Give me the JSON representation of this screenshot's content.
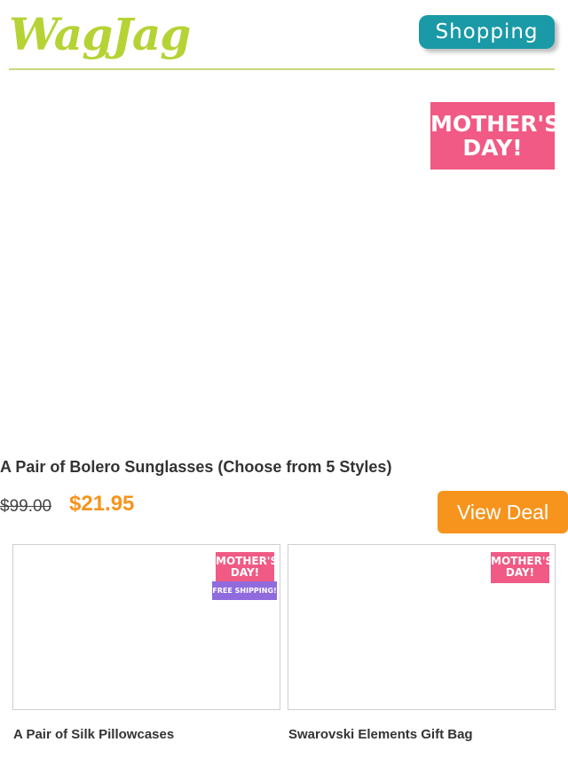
{
  "header": {
    "logo_text": "WagJag",
    "shopping_label": "Shopping"
  },
  "featured_deal": {
    "badge_line1": "MOTHER'S",
    "badge_line2": "DAY!",
    "title": "A Pair of Bolero Sunglasses (Choose from 5 Styles)",
    "original_price": "$99.00",
    "deal_price": "$21.95",
    "cta_label": "View Deal"
  },
  "deals": [
    {
      "title": "A Pair of Silk Pillowcases",
      "badge_line1": "MOTHER'S",
      "badge_line2": "DAY!",
      "shipping_tag": "FREE SHIPPING!"
    },
    {
      "title": "Swarovski Elements Gift Bag",
      "badge_line1": "MOTHER'S",
      "badge_line2": "DAY!"
    }
  ],
  "colors": {
    "brand_green": "#b5d335",
    "shopping_teal": "#1a9aa6",
    "deal_orange": "#f7941d",
    "badge_pink": "#f05a84",
    "shipping_purple": "#8f6bde"
  }
}
